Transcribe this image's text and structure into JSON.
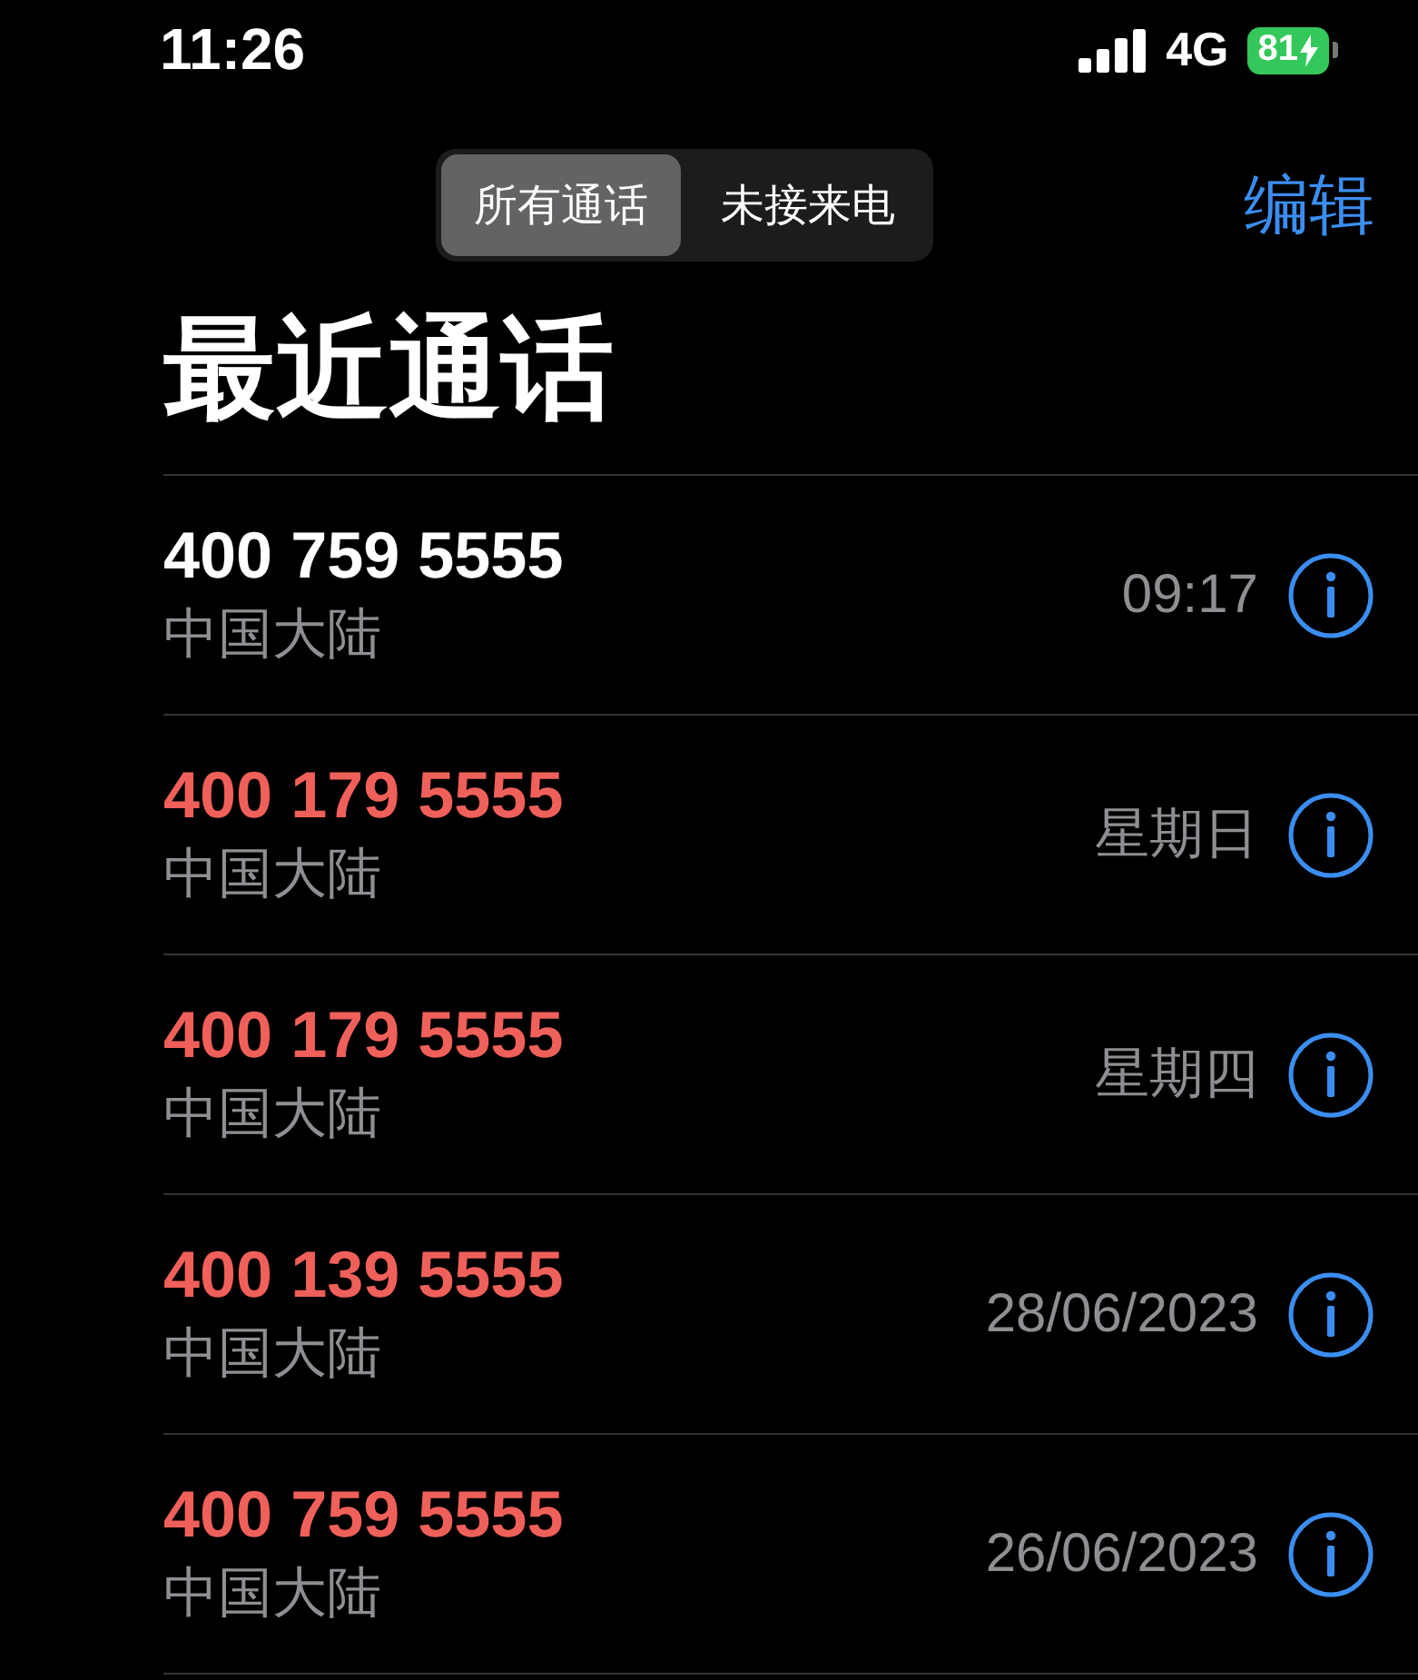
{
  "status_bar": {
    "time": "11:26",
    "network": "4G",
    "battery": "81",
    "charging": true
  },
  "segmented_control": [
    {
      "label": "所有通话",
      "selected": true
    },
    {
      "label": "未接来电",
      "selected": false
    }
  ],
  "edit_button": "编辑",
  "title": "最近通话",
  "calls": [
    {
      "number": "400 759 5555",
      "location": "中国大陆",
      "time": "09:17",
      "missed": false
    },
    {
      "number": "400 179 5555",
      "location": "中国大陆",
      "time": "星期日",
      "missed": true
    },
    {
      "number": "400 179 5555",
      "location": "中国大陆",
      "time": "星期四",
      "missed": true
    },
    {
      "number": "400 139 5555",
      "location": "中国大陆",
      "time": "28/06/2023",
      "missed": true
    },
    {
      "number": "400 759 5555",
      "location": "中国大陆",
      "time": "26/06/2023",
      "missed": true
    }
  ]
}
